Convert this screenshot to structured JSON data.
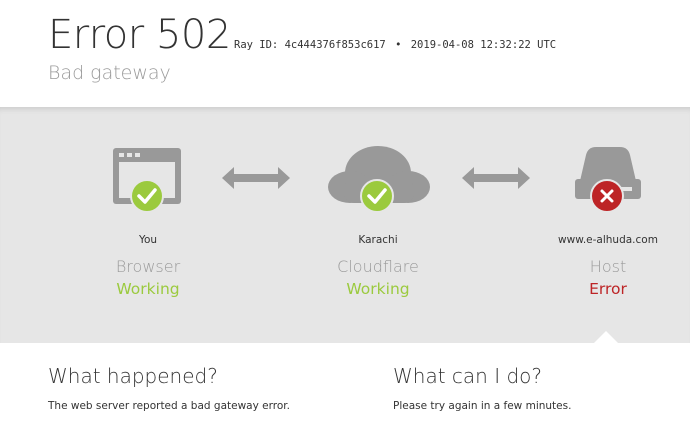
{
  "header": {
    "title": "Error 502",
    "ray_label": "Ray ID:",
    "ray_id": "4c444376f853c617",
    "separator": "•",
    "timestamp": "2019-04-08 12:32:22 UTC",
    "subtitle": "Bad gateway"
  },
  "nodes": [
    {
      "location": "You",
      "kind": "Browser",
      "status": "Working",
      "status_type": "ok",
      "icon": "browser-icon"
    },
    {
      "location": "Karachi",
      "kind": "Cloudflare",
      "status": "Working",
      "status_type": "ok",
      "icon": "cloud-icon"
    },
    {
      "location": "www.e-alhuda.com",
      "kind": "Host",
      "status": "Error",
      "status_type": "error",
      "icon": "server-icon"
    }
  ],
  "what_happened": {
    "heading": "What happened?",
    "text": "The web server reported a bad gateway error."
  },
  "what_can_i_do": {
    "heading": "What can I do?",
    "text": "Please try again in a few minutes."
  },
  "colors": {
    "ok": "#9bca3e",
    "error": "#bd2426",
    "icon_gray": "#999999",
    "band": "#e6e6e6"
  }
}
